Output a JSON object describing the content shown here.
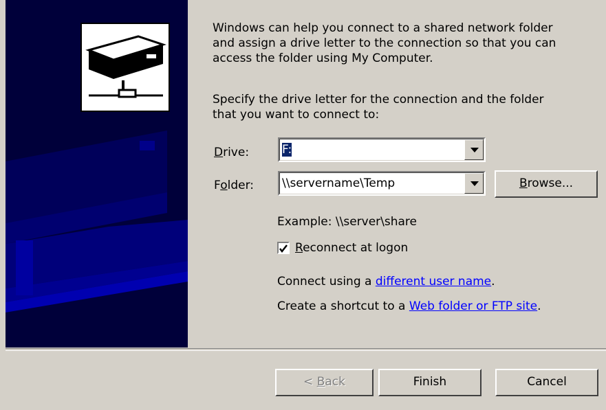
{
  "intro": {
    "para1": [
      "Windows can help you connect to a shared network folder",
      "and assign a drive letter to the connection so that you can",
      "access the folder using My Computer."
    ],
    "para2": [
      "Specify the drive letter for the connection and the folder",
      "that you want to connect to:"
    ]
  },
  "drive": {
    "label_key": "D",
    "label_rest": "rive:",
    "value": "F:"
  },
  "folder": {
    "label_pre": "F",
    "label_key": "o",
    "label_rest": "lder:",
    "value": "\\\\servername\\Temp",
    "browse_key": "B",
    "browse_rest": "rowse..."
  },
  "example": "Example: \\\\server\\share",
  "reconnect": {
    "label_key": "R",
    "label_rest": "econnect at logon",
    "checked": true
  },
  "connect_using": {
    "prefix": "Connect using a ",
    "link": "different user name",
    "suffix": "."
  },
  "shortcut": {
    "prefix": "Create a shortcut to a ",
    "link": "Web folder or FTP site",
    "suffix": "."
  },
  "buttons": {
    "back_pre": "< ",
    "back_key": "B",
    "back_rest": "ack",
    "finish": "Finish",
    "cancel": "Cancel"
  },
  "icons": {
    "wizard_art": "network-drive-icon",
    "dropdown": "chevron-down-icon",
    "checkbox": "checkmark-icon"
  },
  "colors": {
    "banner": "#00003a",
    "selection": "#0a246a",
    "link": "#0000ff",
    "face": "#d4d0c8"
  }
}
